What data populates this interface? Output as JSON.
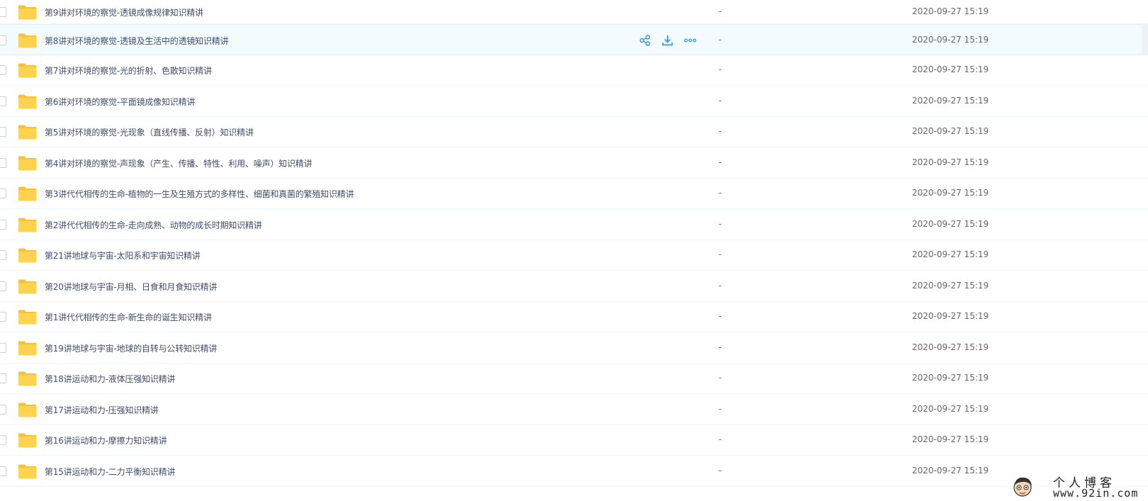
{
  "colors": {
    "folder": "#ffd34f",
    "folder_back": "#f7c23a",
    "action": "#3b9ce0",
    "row_hover": "#f4fbff"
  },
  "hover_actions": [
    {
      "icon": "share-icon"
    },
    {
      "icon": "download-icon"
    },
    {
      "icon": "more-icon"
    }
  ],
  "files": [
    {
      "name": "第9讲对环境的察觉-透镜成像规律知识精讲",
      "size": "-",
      "date": "2020-09-27 15:19"
    },
    {
      "name": "第8讲对环境的察觉-透镜及生活中的透镜知识精讲",
      "size": "-",
      "date": "2020-09-27 15:19",
      "hovered": true
    },
    {
      "name": "第7讲对环境的察觉-光的折射、色散知识精讲",
      "size": "-",
      "date": "2020-09-27 15:19"
    },
    {
      "name": "第6讲对环境的察觉-平面镜成像知识精讲",
      "size": "-",
      "date": "2020-09-27 15:19"
    },
    {
      "name": "第5讲对环境的察觉-光现象（直线传播、反射）知识精讲",
      "size": "-",
      "date": "2020-09-27 15:19"
    },
    {
      "name": "第4讲对环境的察觉-声现象（产生、传播、特性、利用、噪声）知识精讲",
      "size": "-",
      "date": "2020-09-27 15:19"
    },
    {
      "name": "第3讲代代相传的生命-植物的一生及生殖方式的多样性、细菌和真菌的繁殖知识精讲",
      "size": "-",
      "date": "2020-09-27 15:19"
    },
    {
      "name": "第2讲代代相传的生命-走向成熟、动物的成长时期知识精讲",
      "size": "-",
      "date": "2020-09-27 15:19"
    },
    {
      "name": "第21讲地球与宇宙-太阳系和宇宙知识精讲",
      "size": "-",
      "date": "2020-09-27 15:19"
    },
    {
      "name": "第20讲地球与宇宙-月相、日食和月食知识精讲",
      "size": "-",
      "date": "2020-09-27 15:19"
    },
    {
      "name": "第1讲代代相传的生命-新生命的诞生知识精讲",
      "size": "-",
      "date": "2020-09-27 15:19"
    },
    {
      "name": "第19讲地球与宇宙-地球的自转与公转知识精讲",
      "size": "-",
      "date": "2020-09-27 15:19"
    },
    {
      "name": "第18讲运动和力-液体压强知识精讲",
      "size": "-",
      "date": "2020-09-27 15:19"
    },
    {
      "name": "第17讲运动和力-压强知识精讲",
      "size": "-",
      "date": "2020-09-27 15:19"
    },
    {
      "name": "第16讲运动和力-摩擦力知识精讲",
      "size": "-",
      "date": "2020-09-27 15:19"
    },
    {
      "name": "第15讲运动和力-二力平衡知识精讲",
      "size": "-",
      "date": "2020-09-27 15:19"
    }
  ],
  "watermark": {
    "title": "个人博客",
    "url": "www.92in.com"
  }
}
